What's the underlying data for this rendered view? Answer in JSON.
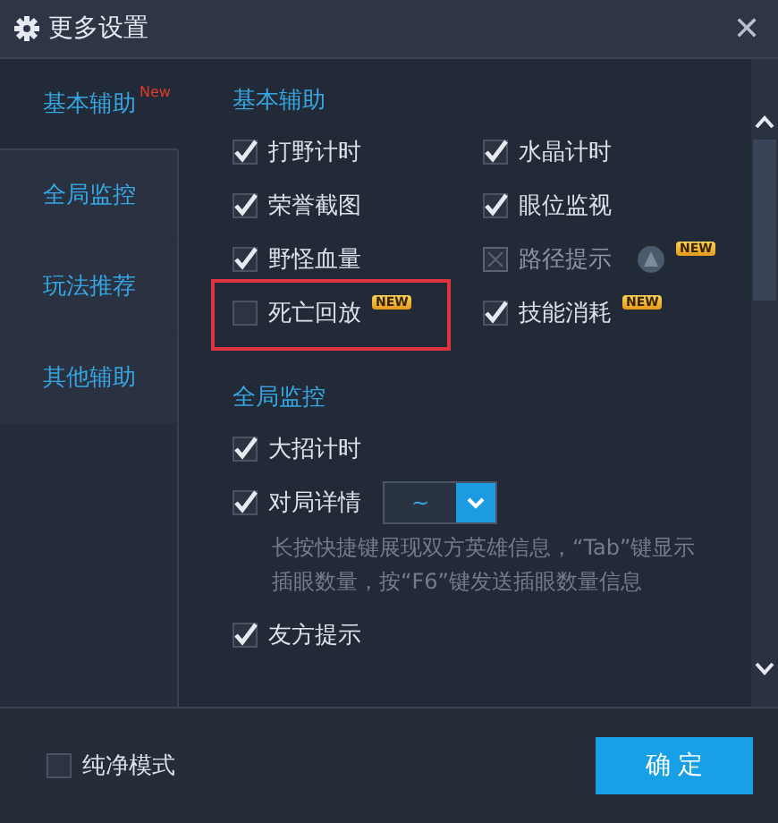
{
  "window": {
    "title": "更多设置",
    "close": "✕"
  },
  "sidebar": {
    "items": [
      {
        "label": "基本辅助",
        "badge": "New",
        "selected": true
      },
      {
        "label": "全局监控",
        "selected": false
      },
      {
        "label": "玩法推荐",
        "selected": false
      },
      {
        "label": "其他辅助",
        "selected": false
      }
    ]
  },
  "basic": {
    "heading": "基本辅助",
    "options": [
      {
        "label": "打野计时",
        "checked": true,
        "disabled": false,
        "highlighted": false
      },
      {
        "label": "水晶计时",
        "checked": true,
        "disabled": false,
        "highlighted": false
      },
      {
        "label": "荣誉截图",
        "checked": true,
        "disabled": false,
        "highlighted": false
      },
      {
        "label": "眼位监视",
        "checked": true,
        "disabled": false,
        "highlighted": false
      },
      {
        "label": "野怪血量",
        "checked": true,
        "disabled": false,
        "highlighted": false
      },
      {
        "label": "路径提示",
        "checked": false,
        "disabled": true,
        "highlighted": false,
        "icon": true,
        "badge": "NEW"
      },
      {
        "label": "死亡回放",
        "checked": false,
        "disabled": false,
        "highlighted": true,
        "badge": "NEW"
      },
      {
        "label": "技能消耗",
        "checked": true,
        "disabled": false,
        "highlighted": false,
        "badge": "NEW"
      }
    ]
  },
  "monitor": {
    "heading": "全局监控",
    "options": [
      {
        "kind": "check",
        "label": "大招计时",
        "checked": true
      },
      {
        "kind": "select",
        "label": "对局详情",
        "checked": true,
        "value": "~",
        "description": "长按快捷键展现双方英雄信息，“Tab”键显示插眼数量，按“F6”键发送插眼数量信息"
      },
      {
        "kind": "check",
        "label": "友方提示",
        "checked": true
      }
    ]
  },
  "footer": {
    "pure_mode": {
      "label": "纯净模式",
      "checked": false
    },
    "confirm": "确 定"
  }
}
